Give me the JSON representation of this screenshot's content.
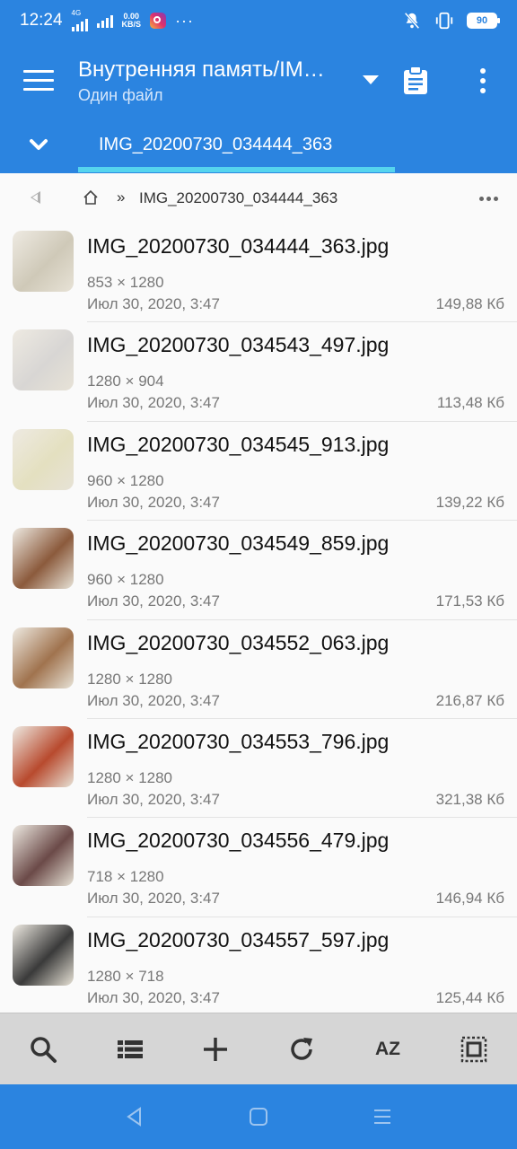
{
  "status": {
    "time": "12:24",
    "network": "4G",
    "speed_value": "0.00",
    "speed_unit": "KB/S",
    "more": "···",
    "battery": "90"
  },
  "app_bar": {
    "title": "Внутренняя память/IM…",
    "subtitle": "Один файл"
  },
  "tab": {
    "label": "IMG_20200730_034444_363"
  },
  "breadcrumb": {
    "separator": "»",
    "path": "IMG_20200730_034444_363"
  },
  "files": [
    {
      "name": "IMG_20200730_034444_363.jpg",
      "dims": "853 × 1280",
      "date": "Июл 30, 2020, 3:47",
      "size": "149,88  Кб",
      "thumb_color": "#cfc9b8"
    },
    {
      "name": "IMG_20200730_034543_497.jpg",
      "dims": "1280 × 904",
      "date": "Июл 30, 2020, 3:47",
      "size": "113,48  Кб",
      "thumb_color": "#d8d6d4"
    },
    {
      "name": "IMG_20200730_034545_913.jpg",
      "dims": "960 × 1280",
      "date": "Июл 30, 2020, 3:47",
      "size": "139,22  Кб",
      "thumb_color": "#e4e0c0"
    },
    {
      "name": "IMG_20200730_034549_859.jpg",
      "dims": "960 × 1280",
      "date": "Июл 30, 2020, 3:47",
      "size": "171,53  Кб",
      "thumb_color": "#8b5a3c"
    },
    {
      "name": "IMG_20200730_034552_063.jpg",
      "dims": "1280 × 1280",
      "date": "Июл 30, 2020, 3:47",
      "size": "216,87  Кб",
      "thumb_color": "#a0734e"
    },
    {
      "name": "IMG_20200730_034553_796.jpg",
      "dims": "1280 × 1280",
      "date": "Июл 30, 2020, 3:47",
      "size": "321,38  Кб",
      "thumb_color": "#b84a2e"
    },
    {
      "name": "IMG_20200730_034556_479.jpg",
      "dims": "718 × 1280",
      "date": "Июл 30, 2020, 3:47",
      "size": "146,94  Кб",
      "thumb_color": "#6b4a48"
    },
    {
      "name": "IMG_20200730_034557_597.jpg",
      "dims": "1280 × 718",
      "date": "Июл 30, 2020, 3:47",
      "size": "125,44  Кб",
      "thumb_color": "#3a3a3a"
    }
  ],
  "toolbar": {
    "sort_label": "AZ"
  },
  "colors": {
    "primary": "#2b84e0",
    "accent": "#55d4ee",
    "toolbar_bg": "#d6d6d6"
  }
}
